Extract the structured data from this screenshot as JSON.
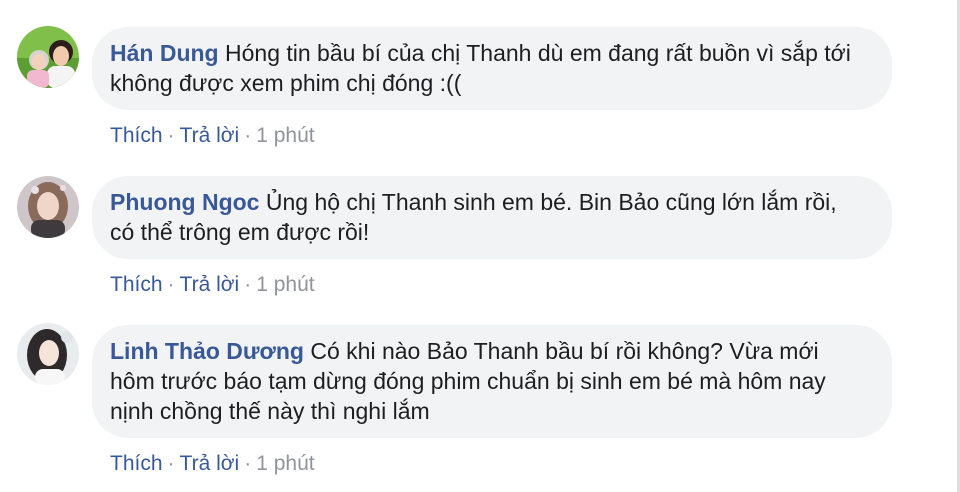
{
  "comments": [
    {
      "author": "Hán Dung",
      "text": "Hóng tin bầu bí của chị Thanh dù em đang rất buồn vì sắp tới không được xem phim chị đóng :((",
      "like_label": "Thích",
      "reply_label": "Trả lời",
      "time": "1 phút"
    },
    {
      "author": "Phuong Ngoc",
      "text": "Ủng hộ chị Thanh sinh em bé. Bin Bảo cũng lớn lắm rồi, có thể trông em được rồi!",
      "like_label": "Thích",
      "reply_label": "Trả lời",
      "time": "1 phút"
    },
    {
      "author": "Linh Thảo Dương",
      "text": "Có khi nào Bảo Thanh bầu bí rồi không? Vừa mới hôm trước báo tạm dừng đóng phim chuẩn bị sinh em bé mà hôm nay nịnh chồng thế này thì nghi lắm",
      "like_label": "Thích",
      "reply_label": "Trả lời",
      "time": "1 phút"
    }
  ],
  "separator": "·",
  "colors": {
    "author": "#385898",
    "bubble": "#f2f3f5",
    "meta": "#90949c",
    "text": "#1c1e21"
  }
}
